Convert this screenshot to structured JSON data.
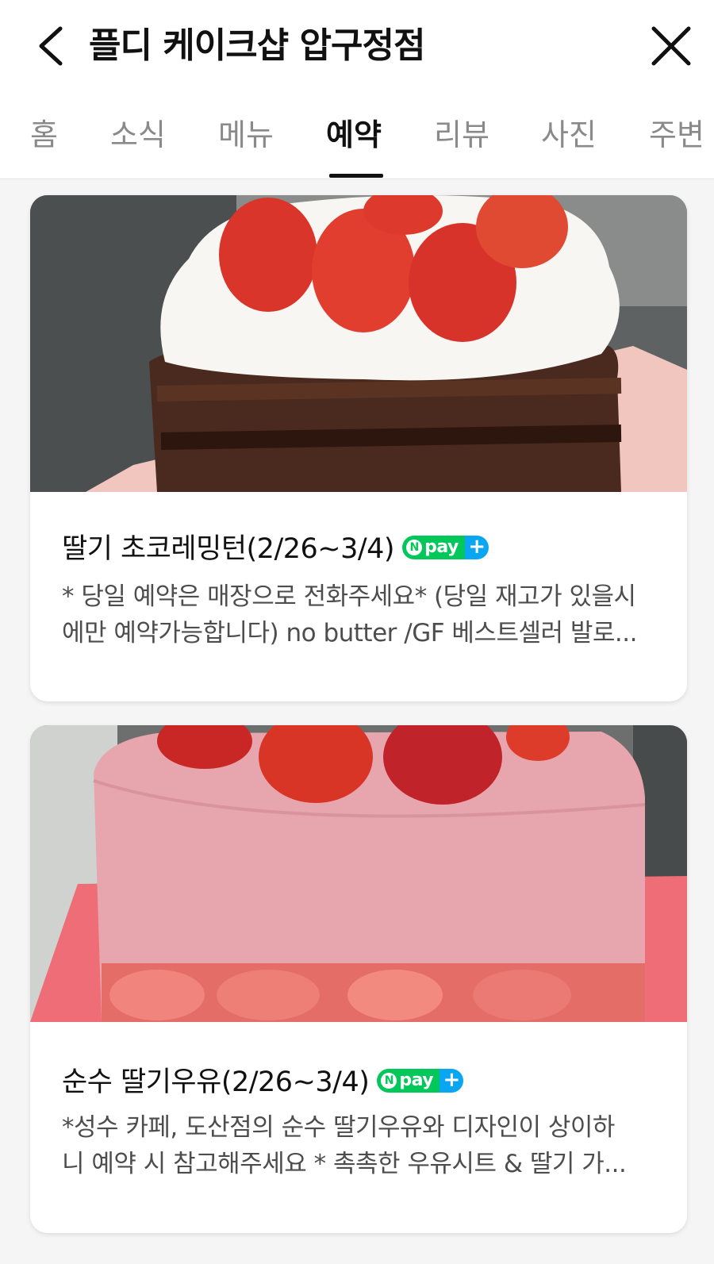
{
  "header": {
    "title": "플디 케이크샵 압구정점",
    "back_icon": "chevron-left-icon",
    "close_icon": "close-icon"
  },
  "tabs": [
    {
      "label": "홈",
      "active": false
    },
    {
      "label": "소식",
      "active": false
    },
    {
      "label": "메뉴",
      "active": false
    },
    {
      "label": "예약",
      "active": true
    },
    {
      "label": "리뷰",
      "active": false
    },
    {
      "label": "사진",
      "active": false
    },
    {
      "label": "주변",
      "active": false
    }
  ],
  "badge": {
    "label": "pay",
    "n_letter": "N",
    "plus": "+",
    "green": "#03c75a",
    "blue": "#0aa6f2"
  },
  "items": [
    {
      "title": "딸기 초코레밍턴(2/26~3/4)",
      "desc_line1": "* 당일 예약은 매장으로 전화주세요* (당일 재고가 있을시",
      "desc_line2": "에만 예약가능합니다) no butter /GF 베스트셀러 발로..."
    },
    {
      "title": "순수 딸기우유(2/26~3/4)",
      "desc_line1": "*성수 카페, 도산점의 순수 딸기우유와 디자인이 상이하",
      "desc_line2": "니 예약 시 참고해주세요 * 촉촉한 우유시트 & 딸기 가..."
    }
  ]
}
